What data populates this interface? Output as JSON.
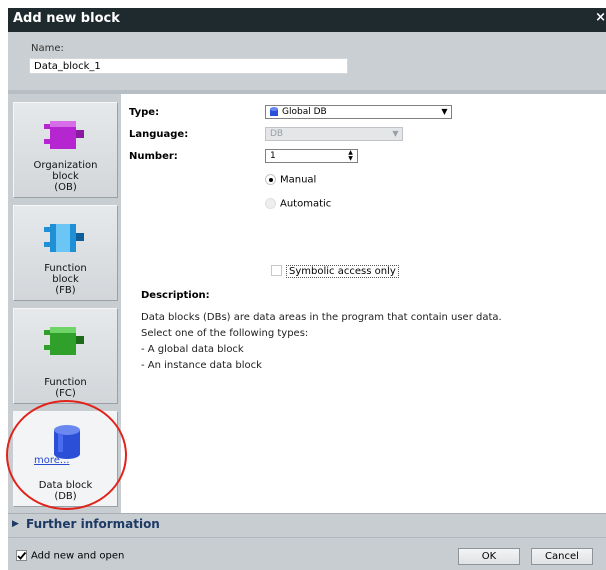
{
  "window": {
    "title": "Add new block",
    "close_glyph": "×"
  },
  "name": {
    "label": "Name:",
    "value": "Data_block_1"
  },
  "blocks": [
    {
      "label": "Organization\nblock\n(OB)",
      "icon": "organization-block-icon",
      "color": "#b526d0"
    },
    {
      "label": "Function\nblock\n(FB)",
      "icon": "function-block-icon",
      "color": "#1f8fd6"
    },
    {
      "label": "Function\n(FC)",
      "icon": "function-icon",
      "color": "#2fa02a"
    },
    {
      "label": "Data block\n(DB)",
      "icon": "data-block-icon",
      "color": "#3a5fe0",
      "selected": true
    }
  ],
  "form": {
    "type_label": "Type:",
    "type_value": "Global DB",
    "language_label": "Language:",
    "language_value": "DB",
    "number_label": "Number:",
    "number_value": "1",
    "manual_label": "Manual",
    "automatic_label": "Automatic",
    "manual_selected": true,
    "symbolic_label": "Symbolic access only",
    "symbolic_checked": false
  },
  "description": {
    "heading": "Description:",
    "lines": [
      "Data blocks (DBs) are data areas in the program that contain user data.",
      "Select one of the following types:",
      "- A global data block",
      "- An instance data block"
    ]
  },
  "more_link": "more...",
  "further_info": "Further information",
  "footer": {
    "add_open_label": "Add new and open",
    "add_open_checked": true,
    "ok_label": "OK",
    "cancel_label": "Cancel"
  },
  "highlight_color": "#e0241b"
}
